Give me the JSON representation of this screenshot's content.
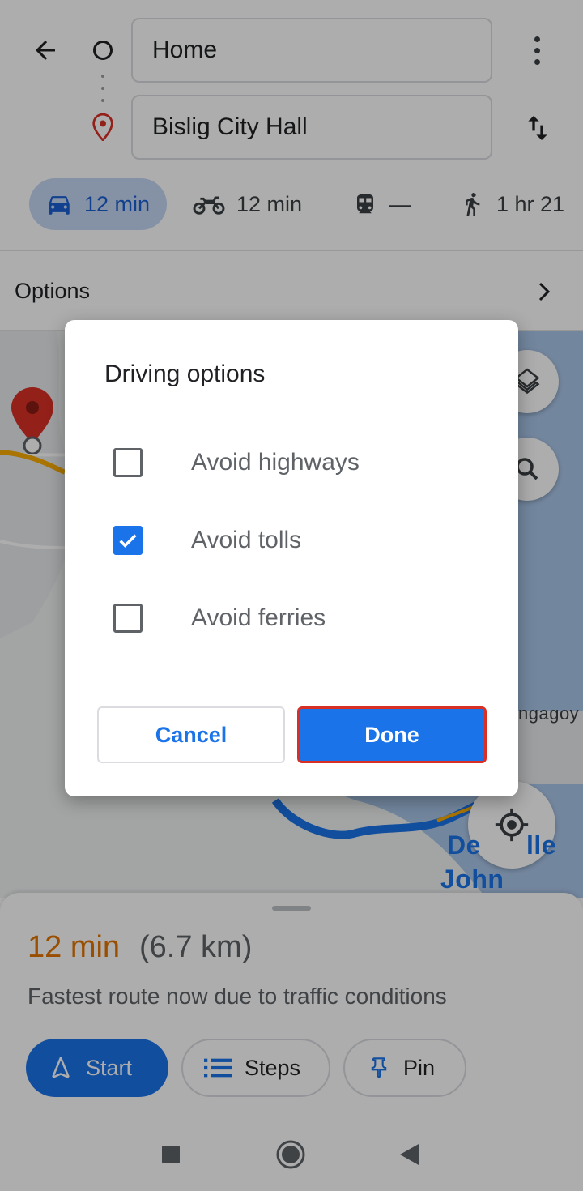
{
  "header": {
    "origin": "Home",
    "destination": "Bislig City Hall",
    "modes": [
      {
        "name": "driving",
        "label": "12 min"
      },
      {
        "name": "motorcycle",
        "label": "12 min"
      },
      {
        "name": "transit",
        "label": "—"
      },
      {
        "name": "walking",
        "label": "1 hr 21"
      }
    ]
  },
  "options_bar": {
    "label": "Options"
  },
  "map": {
    "labels": [
      "De",
      "lle",
      "John Bosco",
      "ngagoy"
    ]
  },
  "sheet": {
    "time": "12 min",
    "distance": "(6.7 km)",
    "description": "Fastest route now due to traffic conditions",
    "buttons": {
      "start": "Start",
      "steps": "Steps",
      "pin": "Pin"
    }
  },
  "dialog": {
    "title": "Driving options",
    "options": [
      {
        "label": "Avoid highways",
        "checked": false
      },
      {
        "label": "Avoid tolls",
        "checked": true
      },
      {
        "label": "Avoid ferries",
        "checked": false
      }
    ],
    "cancel_label": "Cancel",
    "done_label": "Done"
  },
  "colors": {
    "accent": "#1a73e8",
    "eta": "#e37400",
    "highlight_border": "#d93025",
    "destination_pin": "#d93025"
  }
}
